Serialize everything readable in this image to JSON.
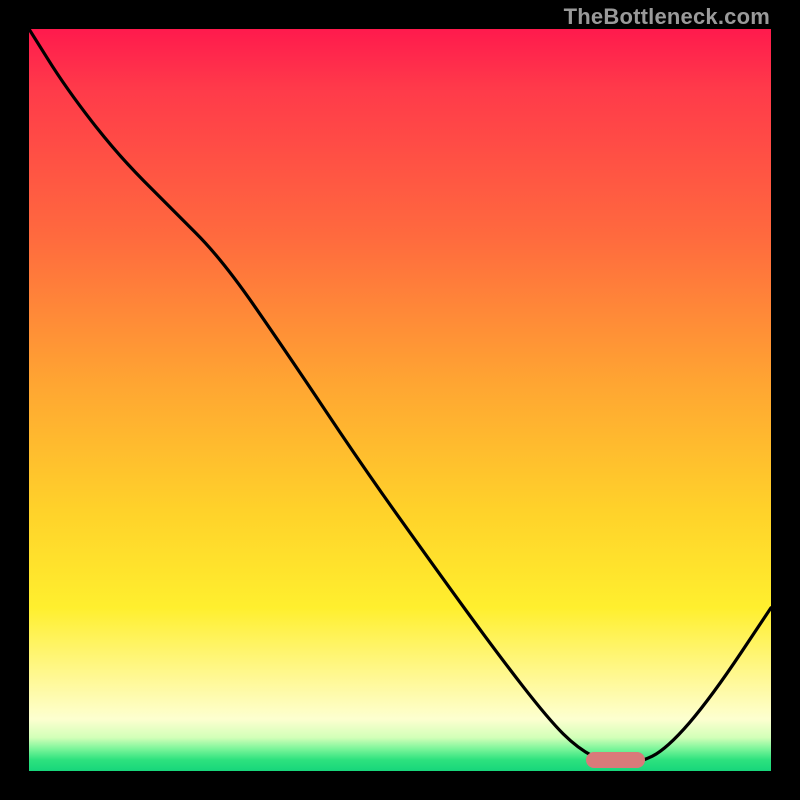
{
  "watermark": "TheBottleneck.com",
  "colors": {
    "frame_border": "#000000",
    "curve_stroke": "#000000",
    "marker_fill": "#d97a7a",
    "gradient_top": "#ff1a4d",
    "gradient_bottom": "#17d67b"
  },
  "chart_data": {
    "type": "line",
    "title": "",
    "xlabel": "",
    "ylabel": "",
    "xlim": [
      0,
      100
    ],
    "ylim": [
      0,
      100
    ],
    "grid": false,
    "legend": false,
    "series": [
      {
        "name": "bottleneck-curve",
        "x": [
          0,
          5,
          12,
          19,
          26,
          35,
          45,
          55,
          63,
          70,
          74,
          78,
          82,
          86,
          92,
          100
        ],
        "y": [
          100,
          92,
          83,
          76,
          69,
          56,
          41,
          27,
          16,
          7,
          3,
          1,
          1,
          3,
          10,
          22
        ]
      }
    ],
    "marker": {
      "name": "optimal-range",
      "x_start": 75,
      "x_end": 83,
      "y": 1.5
    },
    "background": "vertical heat gradient red→yellow→green",
    "note": "x/y are percentages of the plot box; y=0 is bottom edge"
  }
}
